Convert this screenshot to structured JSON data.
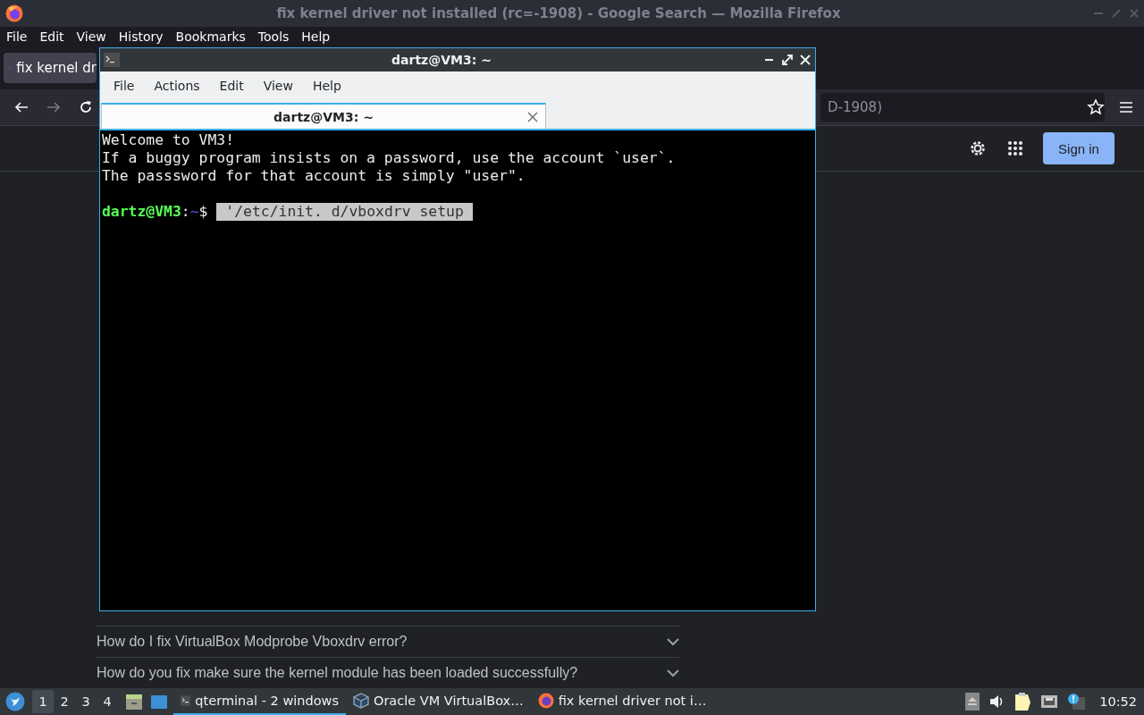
{
  "browser": {
    "title": "fix kernel driver not installed (rc=-1908) - Google Search — Mozilla Firefox",
    "menu": [
      "File",
      "Edit",
      "View",
      "History",
      "Bookmarks",
      "Tools",
      "Help"
    ],
    "tab": {
      "label": "fix kernel dr",
      "selected": true
    },
    "address": "D-1908)",
    "header": {
      "sign_in": "Sign in"
    },
    "questions": [
      {
        "text": "How do I fix VirtualBox Modprobe Vboxdrv error?",
        "expanded": false
      },
      {
        "text": "How do you fix make sure the kernel module has been loaded successfully?",
        "expanded": false
      }
    ]
  },
  "terminal": {
    "title": "dartz@VM3: ~",
    "menu": [
      "File",
      "Actions",
      "Edit",
      "View",
      "Help"
    ],
    "tabs": [
      {
        "label": "dartz@VM3: ~",
        "selected": true
      }
    ],
    "lines": [
      {
        "kind": "text",
        "text": "Welcome to VM3!"
      },
      {
        "kind": "text",
        "text": "If a buggy program insists on a password, use the account `user`."
      },
      {
        "kind": "text",
        "text": "The passsword for that account is simply \"user\"."
      },
      {
        "kind": "blank"
      },
      {
        "kind": "prompt",
        "user": "dartz@VM3",
        "separator": ":",
        "path": "~",
        "symbol": "$",
        "command": "'/etc/init. d/vboxdrv setup",
        "selected": true
      }
    ]
  },
  "taskbar": {
    "desktops": [
      {
        "label": "1",
        "selected": true
      },
      {
        "label": "2",
        "selected": false
      },
      {
        "label": "3",
        "selected": false
      },
      {
        "label": "4",
        "selected": false
      }
    ],
    "tasks": [
      {
        "kind": "terminal",
        "label": "qterminal - 2 windows",
        "selected": true
      },
      {
        "kind": "virtualbox",
        "label": "Oracle VM VirtualBox…",
        "selected": false
      },
      {
        "kind": "firefox",
        "label": "fix kernel driver not i…",
        "selected": false
      }
    ],
    "clock": "10:52"
  }
}
